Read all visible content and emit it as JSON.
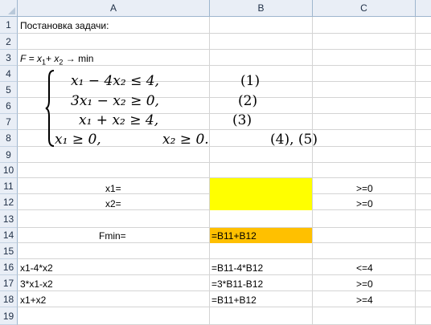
{
  "columns": [
    "A",
    "B",
    "C"
  ],
  "rows": [
    "1",
    "2",
    "3",
    "4",
    "5",
    "6",
    "7",
    "8",
    "9",
    "10",
    "11",
    "12",
    "13",
    "14",
    "15",
    "16",
    "17",
    "18",
    "19"
  ],
  "colors": {
    "yellow_fill": "#ffff00",
    "orange_fill": "#ffc000"
  },
  "cells": {
    "a1": "Постановка задачи:",
    "a3_prefix": "F",
    "a3_eq": "= ",
    "a3_x1": "x",
    "a3_x1_sub": "1",
    "a3_plus": "+ ",
    "a3_x2": "x",
    "a3_x2_sub": "2",
    "a3_arrow": " → min",
    "a11": "x1=",
    "c11": ">=0",
    "a12": "x2=",
    "c12": ">=0",
    "a14": "Fmin=",
    "b14": "=B11+B12",
    "a16": "x1-4*x2",
    "b16": "=B11-4*B12",
    "c16": "<=4",
    "a17": "3*x1-x2",
    "b17": "=3*B11-B12",
    "c17": ">=0",
    "a18": "x1+x2",
    "b18": "=B11+B12",
    "c18": ">=4"
  },
  "system": {
    "line1_lhs": "x₁ − 4x₂ ≤ 4,",
    "line1_tag": "(1)",
    "line2_lhs": "3x₁ − x₂ ≥ 0,",
    "line2_tag": "(2)",
    "line3_lhs": "x₁ + x₂ ≥ 4,",
    "line3_tag": "(3)",
    "line4_a": "x₁ ≥ 0,",
    "line4_b": "x₂ ≥ 0.",
    "line4_tag": "(4), (5)"
  }
}
